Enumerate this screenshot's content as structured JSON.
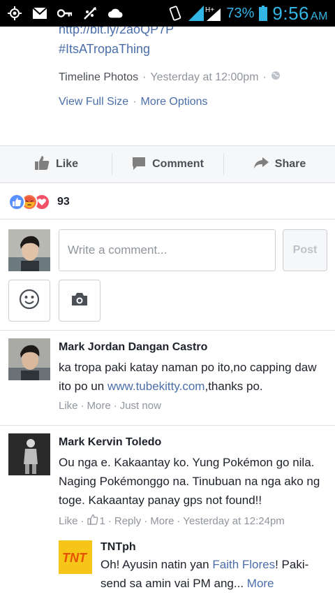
{
  "status_bar": {
    "network": "H+",
    "battery": "73%",
    "time": "9:56",
    "ampm": "AM",
    "icons": [
      "gps-icon",
      "gmail-icon",
      "key-icon",
      "usb-debug-icon",
      "cloud-icon",
      "rotate-icon",
      "signal-icon",
      "battery-icon"
    ]
  },
  "post": {
    "link_url": "http://bit.ly/2aoQP7P",
    "hashtag": "#ItsATropaThing",
    "source": "Timeline Photos",
    "time": "Yesterday at 12:00pm",
    "view_full": "View Full Size",
    "more_options": "More Options",
    "separator": "·"
  },
  "actions": {
    "like": "Like",
    "comment": "Comment",
    "share": "Share"
  },
  "reactions": {
    "count": "93",
    "types": [
      "like",
      "angry",
      "love"
    ],
    "colors": {
      "like": "#5890ff",
      "angry": "#f7714c",
      "love": "#f25268"
    }
  },
  "composer": {
    "placeholder": "Write a comment...",
    "post_label": "Post"
  },
  "comments": [
    {
      "author": "Mark Jordan Dangan Castro",
      "text_before": "ka tropa paki katay naman po ito,no capping daw ito po un ",
      "link": "www.tubekitty.com",
      "text_after": ",thanks po.",
      "like": "Like",
      "more": "More",
      "time": "Just now"
    },
    {
      "author": "Mark Kervin Toledo",
      "text": "Ou nga e. Kakaantay ko. Yung Pokémon go nila. Naging Pokémonggo na. Tinubuan na nga ako ng toge. Kakaantay panay gps not found!!",
      "like": "Like",
      "like_count": "1",
      "reply": "Reply",
      "more": "More",
      "time": "Yesterday at 12:24pm"
    }
  ],
  "reply": {
    "author": "TNTph",
    "avatar_text": "TNT",
    "text_before": "Oh! Ayusin natin yan ",
    "mention": "Faith Flores",
    "text_after": "! Paki-send sa amin vai PM ang...",
    "more": "More"
  },
  "colors": {
    "link_blue": "#4b6ea9",
    "status_blue": "#33b5e5",
    "gray_text": "#90949c"
  }
}
